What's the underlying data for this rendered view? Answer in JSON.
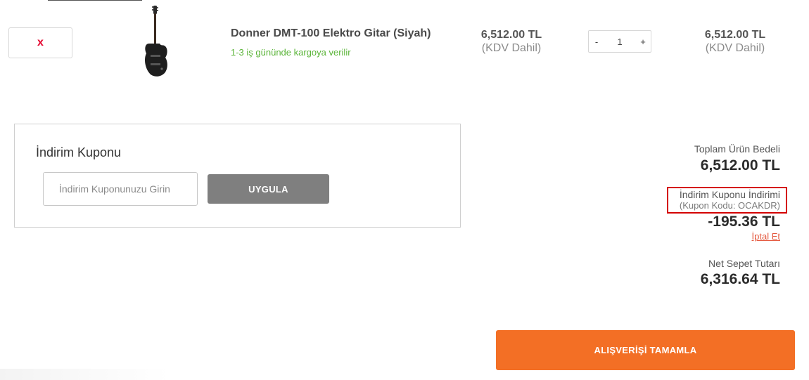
{
  "cart_item": {
    "remove_label": "x",
    "image_icon": "electric-guitar-image",
    "name": "Donner DMT-100 Elektro Gitar (Siyah)",
    "shipping_note": "1-3 iş gününde kargoya verilir",
    "unit_price": "6,512.00 TL",
    "unit_price_vat": "(KDV Dahil)",
    "quantity": "1",
    "qty_minus": "-",
    "qty_plus": "+",
    "line_total": "6,512.00 TL",
    "line_total_vat": "(KDV Dahil)"
  },
  "coupon": {
    "title": "İndirim Kuponu",
    "input_value": "",
    "input_placeholder": "İndirim Kuponunuzu Girin",
    "apply_label": "UYGULA"
  },
  "summary": {
    "total_label": "Toplam Ürün Bedeli",
    "total_value": "6,512.00 TL",
    "discount_label": "İndirim Kuponu İndirimi",
    "discount_code": "(Kupon Kodu: OCAKDR)",
    "discount_value": "-195.36 TL",
    "cancel_label": "İptal Et",
    "net_label": "Net Sepet Tutarı",
    "net_value": "6,316.64 TL"
  },
  "checkout": {
    "label": "ALIŞVERİŞİ TAMAMLA"
  },
  "colors": {
    "checkout_bg": "#f36f25",
    "apply_bg": "#7f7f7f",
    "remove_x": "#e4002b",
    "shipping_text": "#5ab438",
    "highlight_border": "#d40000",
    "cancel_link": "#e4573d"
  }
}
